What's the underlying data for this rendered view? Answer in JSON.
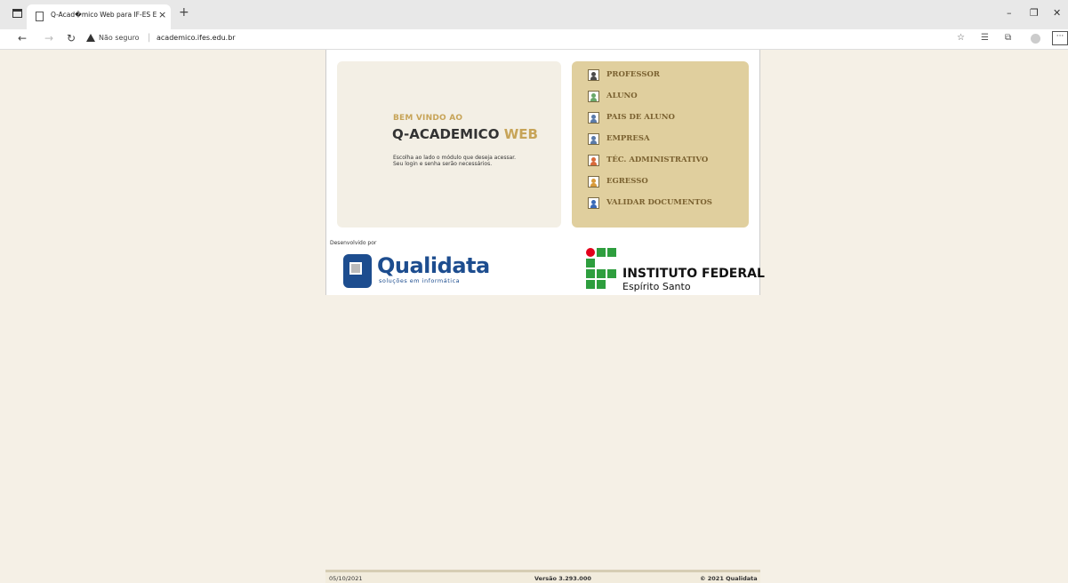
{
  "browser": {
    "tab_title": "Q-Acad�mico Web para IF-ES E",
    "tab_close": "×",
    "new_tab": "+",
    "insecure_label": "Não seguro",
    "url": "academico.ifes.edu.br",
    "menu_more": "···"
  },
  "welcome": {
    "line1": "BEM VINDO AO",
    "line2_main": "Q-ACADEMICO",
    "line2_accent": "WEB",
    "description": "Escolha ao lado o módulo que deseja acessar. Seu login e senha serão necessários."
  },
  "menu": {
    "items": [
      {
        "label": "PROFESSOR",
        "icon": "professor-icon",
        "color": "#4a4a4a"
      },
      {
        "label": "ALUNO",
        "icon": "aluno-icon",
        "color": "#6aa86a"
      },
      {
        "label": "PAIS DE ALUNO",
        "icon": "pais-de-aluno-icon",
        "color": "#5a7aa8"
      },
      {
        "label": "EMPRESA",
        "icon": "empresa-icon",
        "color": "#5a7aa8"
      },
      {
        "label": "TÉC. ADMINISTRATIVO",
        "icon": "tecnico-administrativo-icon",
        "color": "#d86a3a"
      },
      {
        "label": "EGRESSO",
        "icon": "egresso-icon",
        "color": "#d89a3a"
      },
      {
        "label": "VALIDAR DOCUMENTOS",
        "icon": "validar-documentos-icon",
        "color": "#3a6ab8"
      }
    ]
  },
  "developer": {
    "label": "Desenvolvido por",
    "company": "Qualidata",
    "tagline": "soluções em informática"
  },
  "institution": {
    "name": "INSTITUTO FEDERAL",
    "campus": "Espírito Santo"
  },
  "footer": {
    "date": "05/10/2021",
    "version": "Versão 3.293.000",
    "copyright": "© 2021 Qualidata"
  }
}
